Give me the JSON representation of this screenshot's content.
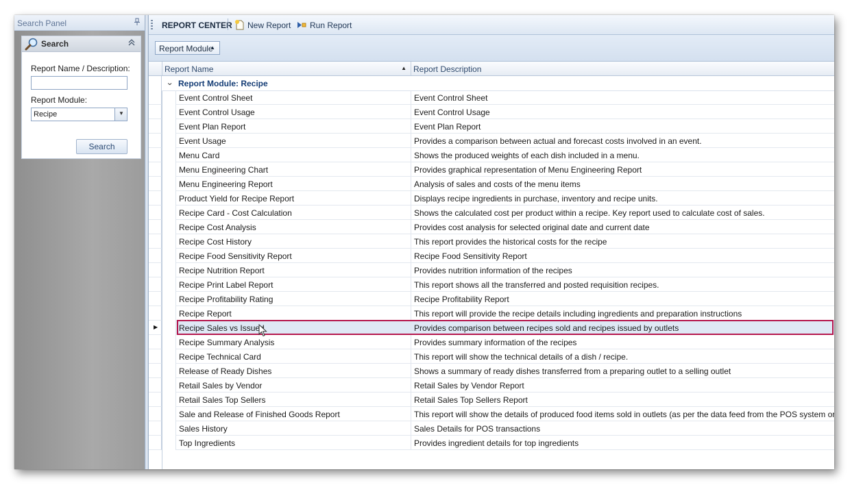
{
  "left_panel": {
    "title": "Search Panel",
    "pin_icon": "pin-icon",
    "search_section": {
      "title": "Search",
      "icon": "magnifier-icon",
      "collapse_icon": "double-chevron-up-icon",
      "name_label": "Report Name / Description:",
      "name_value": "",
      "module_label": "Report Module:",
      "module_value": "Recipe",
      "button_label": "Search"
    }
  },
  "toolbar": {
    "title": "REPORT CENTER",
    "new_report_label": "New Report",
    "run_report_label": "Run Report"
  },
  "group_bar": {
    "chip_label": "Report Module",
    "chip_sort": "ascending"
  },
  "grid": {
    "columns": [
      "Report Name",
      "Report Description"
    ],
    "sorted_column": "Report Name",
    "group_label": "Report Module: Recipe",
    "selected_index": 16,
    "rows": [
      {
        "name": "Event Control Sheet",
        "desc": "Event Control Sheet"
      },
      {
        "name": "Event Control Usage",
        "desc": "Event Control Usage"
      },
      {
        "name": "Event Plan Report",
        "desc": "Event Plan Report"
      },
      {
        "name": "Event Usage",
        "desc": "Provides a comparison between actual and forecast costs involved in an event."
      },
      {
        "name": "Menu Card",
        "desc": "Shows the produced weights of each dish included in a menu."
      },
      {
        "name": "Menu Engineering Chart",
        "desc": "Provides graphical representation of Menu Engineering Report"
      },
      {
        "name": "Menu Engineering Report",
        "desc": "Analysis of sales and costs of the menu items"
      },
      {
        "name": "Product Yield for Recipe Report",
        "desc": "Displays recipe ingredients in purchase, inventory and recipe units."
      },
      {
        "name": "Recipe Card - Cost Calculation",
        "desc": "Shows the calculated cost per product within a recipe. Key report used to calculate cost of sales."
      },
      {
        "name": "Recipe Cost Analysis",
        "desc": "Provides cost analysis for selected original date and current date"
      },
      {
        "name": "Recipe Cost History",
        "desc": "This report provides the historical costs for the recipe"
      },
      {
        "name": "Recipe Food Sensitivity Report",
        "desc": "Recipe Food Sensitivity Report"
      },
      {
        "name": "Recipe Nutrition Report",
        "desc": "Provides nutrition information of the recipes"
      },
      {
        "name": "Recipe Print Label Report",
        "desc": "This report shows all the transferred and posted requisition recipes."
      },
      {
        "name": "Recipe Profitability Rating",
        "desc": "Recipe Profitability Report"
      },
      {
        "name": "Recipe Report",
        "desc": "This report will provide the recipe details including ingredients and preparation instructions"
      },
      {
        "name": "Recipe Sales vs Issued",
        "desc": "Provides comparison between recipes sold and recipes issued by outlets"
      },
      {
        "name": "Recipe Summary Analysis",
        "desc": "Provides summary information of the recipes"
      },
      {
        "name": "Recipe Technical Card",
        "desc": "This report will show the technical details of a dish / recipe."
      },
      {
        "name": "Release of Ready Dishes",
        "desc": "Shows a summary of ready dishes transferred from a preparing outlet to a selling outlet"
      },
      {
        "name": "Retail Sales by Vendor",
        "desc": "Retail Sales by Vendor Report"
      },
      {
        "name": "Retail Sales Top Sellers",
        "desc": "Retail Sales Top Sellers Report"
      },
      {
        "name": "Sale and Release of Finished Goods Report",
        "desc": "This report will show the details of produced food items sold in outlets (as per the data feed from the POS system or manually-e"
      },
      {
        "name": "Sales History",
        "desc": "Sales Details for POS transactions"
      },
      {
        "name": "Top Ingredients",
        "desc": "Provides ingredient details for top ingredients"
      }
    ]
  },
  "colors": {
    "selection_outline": "#b5164c",
    "group_text": "#153d75",
    "selected_row_bg": "#dfe8f5"
  }
}
